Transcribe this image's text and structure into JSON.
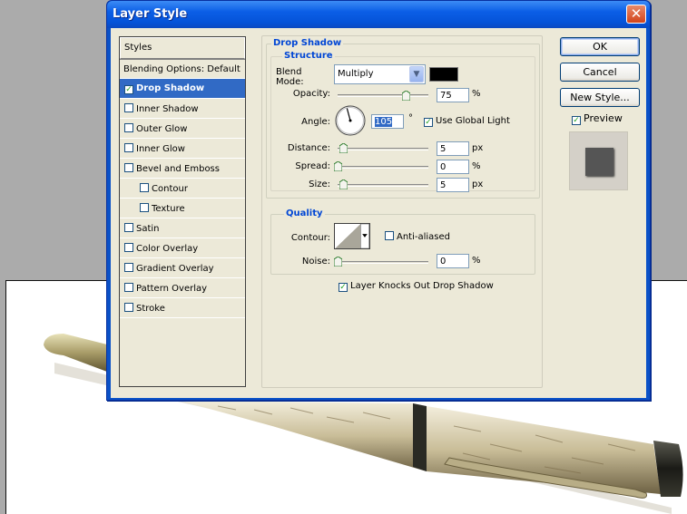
{
  "dialog": {
    "title": "Layer Style",
    "close_glyph": "✕"
  },
  "styles_panel": {
    "header": "Styles",
    "blending_options": "Blending Options: Default",
    "items": [
      {
        "label": "Drop Shadow",
        "checked": true,
        "selected": true,
        "indent": false
      },
      {
        "label": "Inner Shadow",
        "checked": false,
        "selected": false,
        "indent": false
      },
      {
        "label": "Outer Glow",
        "checked": false,
        "selected": false,
        "indent": false
      },
      {
        "label": "Inner Glow",
        "checked": false,
        "selected": false,
        "indent": false
      },
      {
        "label": "Bevel and Emboss",
        "checked": false,
        "selected": false,
        "indent": false
      },
      {
        "label": "Contour",
        "checked": false,
        "selected": false,
        "indent": true
      },
      {
        "label": "Texture",
        "checked": false,
        "selected": false,
        "indent": true
      },
      {
        "label": "Satin",
        "checked": false,
        "selected": false,
        "indent": false
      },
      {
        "label": "Color Overlay",
        "checked": false,
        "selected": false,
        "indent": false
      },
      {
        "label": "Gradient Overlay",
        "checked": false,
        "selected": false,
        "indent": false
      },
      {
        "label": "Pattern Overlay",
        "checked": false,
        "selected": false,
        "indent": false
      },
      {
        "label": "Stroke",
        "checked": false,
        "selected": false,
        "indent": false
      }
    ]
  },
  "drop_shadow": {
    "title": "Drop Shadow",
    "structure_title": "Structure",
    "blend_mode_label": "Blend Mode:",
    "blend_mode_value": "Multiply",
    "shadow_color": "#000000",
    "opacity_label": "Opacity:",
    "opacity_value": "75",
    "opacity_fraction": 0.75,
    "percent": "%",
    "px": "px",
    "angle_label": "Angle:",
    "angle_value": "105",
    "degree": "°",
    "use_global_light": "Use Global Light",
    "use_global_light_checked": true,
    "distance_label": "Distance:",
    "distance_value": "5",
    "spread_label": "Spread:",
    "spread_value": "0",
    "size_label": "Size:",
    "size_value": "5"
  },
  "quality": {
    "title": "Quality",
    "contour_label": "Contour:",
    "anti_aliased": "Anti-aliased",
    "anti_aliased_checked": false,
    "noise_label": "Noise:",
    "noise_value": "0"
  },
  "layer_knocks_out": {
    "label": "Layer Knocks Out Drop Shadow",
    "checked": true
  },
  "buttons": {
    "ok": "OK",
    "cancel": "Cancel",
    "new_style": "New Style..."
  },
  "preview": {
    "label": "Preview",
    "checked": true
  },
  "colors": {
    "title_bar": "#0a5ee6",
    "selection": "#316ac5",
    "group_title": "#0046d5",
    "dialog_face": "#ece9d8"
  }
}
